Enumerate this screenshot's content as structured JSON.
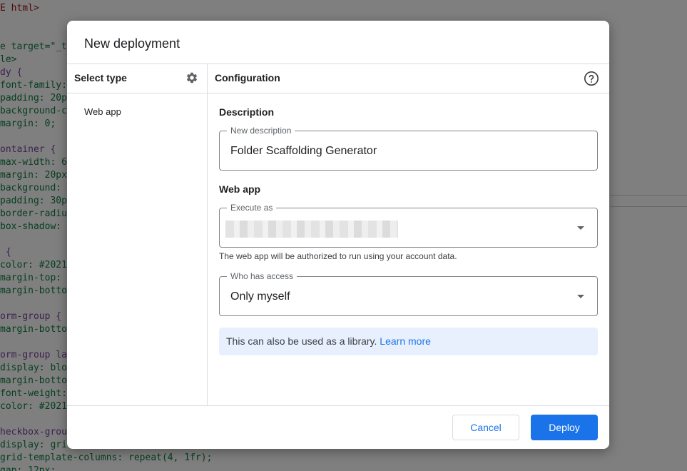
{
  "background_code": [
    {
      "text": "E html>",
      "color": "#a31515"
    },
    {
      "text": "",
      "color": "#0b7d3e"
    },
    {
      "text": "",
      "color": "#0b7d3e"
    },
    {
      "text": "e target=\"_t",
      "color": "#0b7d3e"
    },
    {
      "text": "le>",
      "color": "#0b7d3e"
    },
    {
      "text": "dy {",
      "color": "#7a3e9d"
    },
    {
      "text": "font-family:",
      "color": "#0b7d3e"
    },
    {
      "text": "padding: 20p",
      "color": "#0b7d3e"
    },
    {
      "text": "background-c",
      "color": "#0b7d3e"
    },
    {
      "text": "margin: 0;",
      "color": "#0b7d3e"
    },
    {
      "text": "",
      "color": "#0b7d3e"
    },
    {
      "text": "ontainer {",
      "color": "#7a3e9d"
    },
    {
      "text": "max-width: 6",
      "color": "#0b7d3e"
    },
    {
      "text": "margin: 20px",
      "color": "#0b7d3e"
    },
    {
      "text": "background: ",
      "color": "#0b7d3e"
    },
    {
      "text": "padding: 30p",
      "color": "#0b7d3e"
    },
    {
      "text": "border-radiu",
      "color": "#0b7d3e"
    },
    {
      "text": "box-shadow: ",
      "color": "#0b7d3e"
    },
    {
      "text": "",
      "color": "#0b7d3e"
    },
    {
      "text": " {",
      "color": "#7a3e9d"
    },
    {
      "text": "color: #2021",
      "color": "#0b7d3e"
    },
    {
      "text": "margin-top: ",
      "color": "#0b7d3e"
    },
    {
      "text": "margin-botto",
      "color": "#0b7d3e"
    },
    {
      "text": "",
      "color": "#0b7d3e"
    },
    {
      "text": "orm-group {",
      "color": "#7a3e9d"
    },
    {
      "text": "margin-botto",
      "color": "#0b7d3e"
    },
    {
      "text": "",
      "color": "#0b7d3e"
    },
    {
      "text": "orm-group la",
      "color": "#7a3e9d"
    },
    {
      "text": "display: blo",
      "color": "#0b7d3e"
    },
    {
      "text": "margin-botto",
      "color": "#0b7d3e"
    },
    {
      "text": "font-weight:",
      "color": "#0b7d3e"
    },
    {
      "text": "color: #2021",
      "color": "#0b7d3e"
    },
    {
      "text": "",
      "color": "#0b7d3e"
    },
    {
      "text": "heckbox-grou",
      "color": "#7a3e9d"
    },
    {
      "text": "display: gri",
      "color": "#0b7d3e"
    },
    {
      "text": "grid-template-columns: repeat(4, 1fr);",
      "color": "#0b7d3e"
    },
    {
      "text": "gap: 12px;",
      "color": "#0b7d3e"
    }
  ],
  "dialog": {
    "title": "New deployment",
    "left_panel": {
      "heading": "Select type",
      "settings_icon": "gear-icon",
      "items": [
        "Web app"
      ]
    },
    "right_panel": {
      "heading": "Configuration",
      "help_icon": "help-circle-icon",
      "description_section": {
        "label": "Description",
        "field_label": "New description",
        "field_value": "Folder Scaffolding Generator"
      },
      "webapp_section": {
        "label": "Web app",
        "execute_as": {
          "label": "Execute as",
          "value_redacted": true
        },
        "helper_text": "The web app will be authorized to run using your account data.",
        "who_has_access": {
          "label": "Who has access",
          "value": "Only myself"
        }
      },
      "info_banner": {
        "text": "This can also be used as a library.",
        "link_text": "Learn more"
      }
    },
    "footer": {
      "cancel_label": "Cancel",
      "deploy_label": "Deploy"
    }
  },
  "colors": {
    "accent": "#1a73e8",
    "info_banner_bg": "#e8f0fe",
    "divider": "#dadce0"
  }
}
